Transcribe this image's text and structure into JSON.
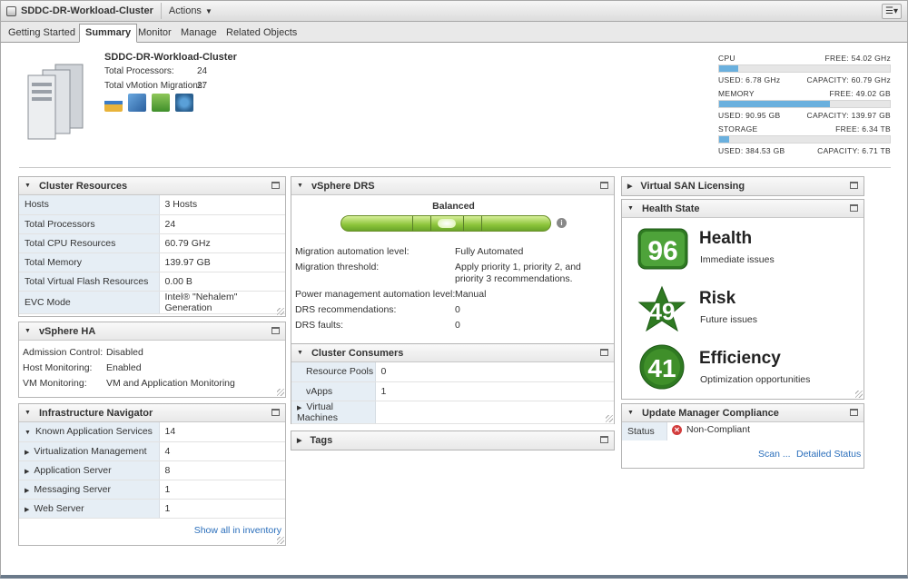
{
  "window": {
    "title": "SDDC-DR-Workload-Cluster",
    "actions_label": "Actions"
  },
  "tabs": [
    {
      "label": "Getting Started"
    },
    {
      "label": "Summary"
    },
    {
      "label": "Monitor"
    },
    {
      "label": "Manage"
    },
    {
      "label": "Related Objects"
    }
  ],
  "summary": {
    "name": "SDDC-DR-Workload-Cluster",
    "rows": [
      {
        "label": "Total Processors:",
        "value": "24"
      },
      {
        "label": "Total vMotion Migrations:",
        "value": "27"
      }
    ]
  },
  "resources": [
    {
      "name": "CPU",
      "free": "FREE: 54.02 GHz",
      "used": "USED: 6.78 GHz",
      "capacity": "CAPACITY: 60.79 GHz",
      "used_fraction": 0.11
    },
    {
      "name": "MEMORY",
      "free": "FREE: 49.02 GB",
      "used": "USED: 90.95 GB",
      "capacity": "CAPACITY: 139.97 GB",
      "used_fraction": 0.65
    },
    {
      "name": "STORAGE",
      "free": "FREE: 6.34 TB",
      "used": "USED: 384.53 GB",
      "capacity": "CAPACITY: 6.71 TB",
      "used_fraction": 0.056
    }
  ],
  "cluster_resources": {
    "title": "Cluster Resources",
    "rows": [
      {
        "k": "Hosts",
        "v": "3 Hosts"
      },
      {
        "k": "Total Processors",
        "v": "24"
      },
      {
        "k": "Total CPU Resources",
        "v": "60.79 GHz"
      },
      {
        "k": "Total Memory",
        "v": "139.97 GB"
      },
      {
        "k": "Total Virtual Flash Resources",
        "v": "0.00 B"
      },
      {
        "k": "EVC Mode",
        "v": "Intel® \"Nehalem\" Generation"
      }
    ]
  },
  "vsphere_ha": {
    "title": "vSphere HA",
    "rows": [
      {
        "k": "Admission Control:",
        "v": "Disabled"
      },
      {
        "k": "Host Monitoring:",
        "v": "Enabled"
      },
      {
        "k": "VM Monitoring:",
        "v": "VM and Application Monitoring"
      }
    ]
  },
  "infra_nav": {
    "title": "Infrastructure Navigator",
    "rows": [
      {
        "k": "Known Application Services",
        "v": "14"
      },
      {
        "k": "Virtualization Management",
        "v": "4"
      },
      {
        "k": "Application Server",
        "v": "8"
      },
      {
        "k": "Messaging Server",
        "v": "1"
      },
      {
        "k": "Web Server",
        "v": "1"
      }
    ],
    "link": "Show all in inventory"
  },
  "drs": {
    "title": "vSphere DRS",
    "status": "Balanced",
    "rows": [
      {
        "k": "Migration automation level:",
        "v": "Fully Automated"
      },
      {
        "k": "Migration threshold:",
        "v": "Apply priority 1, priority 2, and priority 3 recommendations."
      },
      {
        "k": "Power management automation level:",
        "v": "Manual"
      },
      {
        "k": "DRS recommendations:",
        "v": "0"
      },
      {
        "k": "DRS faults:",
        "v": "0"
      }
    ]
  },
  "consumers": {
    "title": "Cluster Consumers",
    "rows": [
      {
        "k": "Resource Pools",
        "v": "0"
      },
      {
        "k": "vApps",
        "v": "1"
      },
      {
        "k": "Virtual Machines",
        "v": ""
      }
    ]
  },
  "tags": {
    "title": "Tags"
  },
  "vsan": {
    "title": "Virtual SAN Licensing"
  },
  "health_state": {
    "title": "Health State",
    "items": [
      {
        "score": "96",
        "title": "Health",
        "sub": "Immediate issues"
      },
      {
        "score": "49",
        "title": "Risk",
        "sub": "Future issues"
      },
      {
        "score": "41",
        "title": "Efficiency",
        "sub": "Optimization opportunities"
      }
    ]
  },
  "update_manager": {
    "title": "Update Manager Compliance",
    "status_label": "Status",
    "status_value": "Non-Compliant",
    "scan_link": "Scan ...",
    "detail_link": "Detailed Status"
  },
  "colors": {
    "accent_green": "#3f8f2a",
    "bar_blue": "#6ab0de",
    "link": "#2a6ebb",
    "error_red": "#d23c3c"
  }
}
